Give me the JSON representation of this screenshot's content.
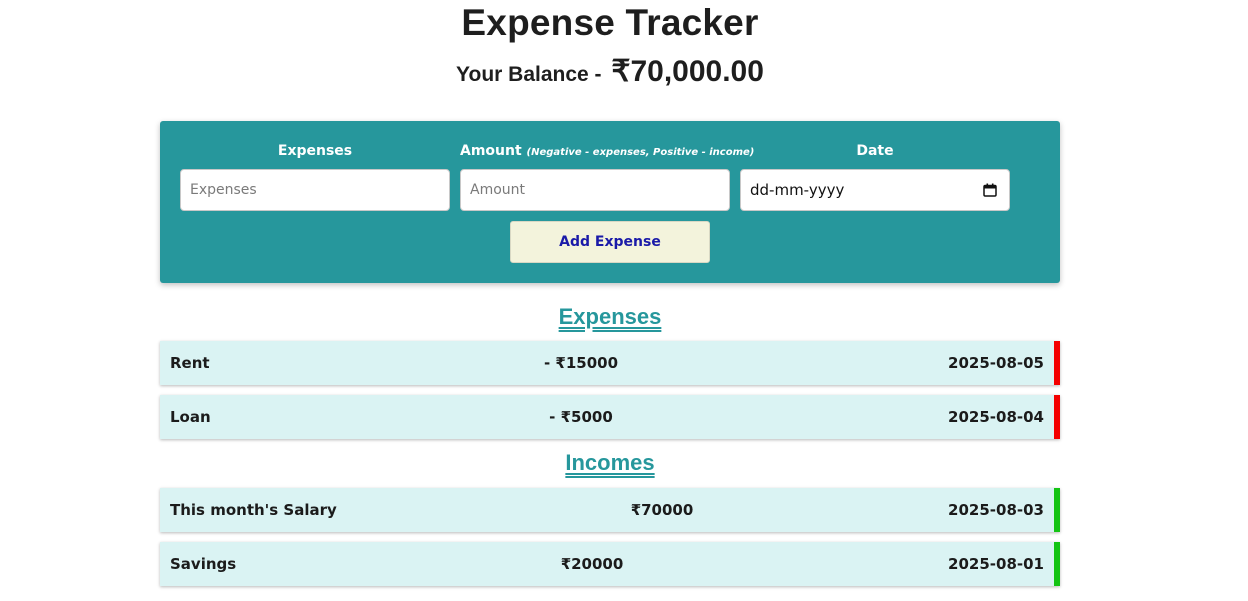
{
  "header": {
    "title": "Expense Tracker",
    "balance_label": "Your Balance - ",
    "balance_value": "₹70,000.00"
  },
  "form": {
    "expenses_label": "Expenses",
    "amount_label": "Amount",
    "amount_hint": "(Negative - expenses, Positive - income)",
    "date_label": "Date",
    "expenses_placeholder": "Expenses",
    "amount_placeholder": "Amount",
    "date_placeholder": "dd-mm-yyyy",
    "add_button": "Add Expense",
    "calendar_icon": "calendar-icon"
  },
  "sections": {
    "expenses_title": "Expenses",
    "incomes_title": "Incomes"
  },
  "expenses": [
    {
      "name": "Rent",
      "amount": "- ₹15000",
      "date": "2025-08-05"
    },
    {
      "name": "Loan",
      "amount": "- ₹5000",
      "date": "2025-08-04"
    }
  ],
  "incomes": [
    {
      "name": "This month's Salary",
      "amount": "₹70000",
      "date": "2025-08-03"
    },
    {
      "name": "Savings",
      "amount": "₹20000",
      "date": "2025-08-01"
    }
  ],
  "colors": {
    "accent": "#26979c",
    "row_bg": "#daf3f3",
    "expense_marker": "#f40000",
    "income_marker": "#14c414",
    "button_bg": "#f3f3dc",
    "button_text": "#1a1aa8"
  }
}
